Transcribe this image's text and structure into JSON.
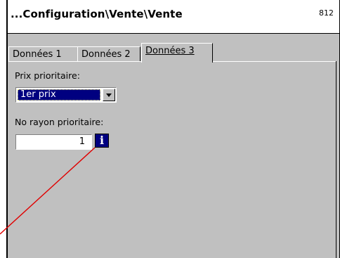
{
  "window": {
    "title": "...Configuration\\Vente\\Vente",
    "code": "812"
  },
  "tabs": [
    {
      "label": "Données 1"
    },
    {
      "label": "Données 2"
    },
    {
      "label": "Données 3"
    }
  ],
  "active_tab": "Données 3",
  "fields": {
    "prix_label": "Prix prioritaire:",
    "prix_value": "1er prix",
    "rayon_label": "No rayon prioritaire:",
    "rayon_value": "1"
  },
  "icons": {
    "info": "i"
  },
  "colors": {
    "selection": "#000080",
    "background": "#c0c0c0",
    "annotation_line": "#e00000"
  }
}
